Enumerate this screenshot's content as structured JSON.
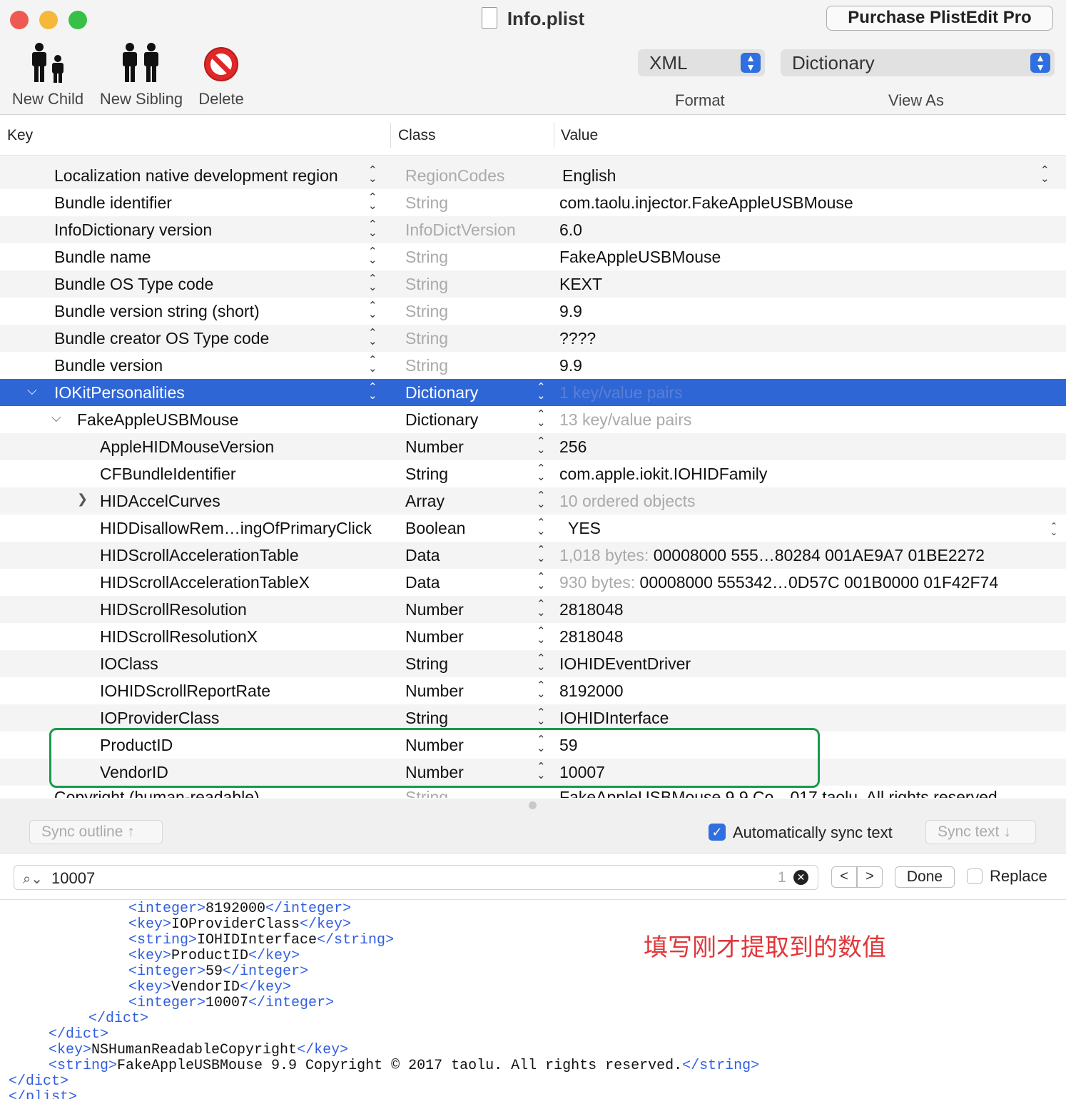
{
  "window": {
    "title": "Info.plist",
    "purchase_button": "Purchase PlistEdit Pro"
  },
  "toolbar": {
    "new_child": "New Child",
    "new_sibling": "New Sibling",
    "delete": "Delete",
    "format_value": "XML",
    "format_label": "Format",
    "view_as_value": "Dictionary",
    "view_as_label": "View As"
  },
  "columns": {
    "key": "Key",
    "class": "Class",
    "value": "Value"
  },
  "rows": [
    {
      "key": "Localization native development region",
      "cls": "RegionCodes",
      "value": "English"
    },
    {
      "key": "Bundle identifier",
      "cls": "String",
      "value": "com.taolu.injector.FakeAppleUSBMouse"
    },
    {
      "key": "InfoDictionary version",
      "cls": "InfoDictVersion",
      "value": "6.0"
    },
    {
      "key": "Bundle name",
      "cls": "String",
      "value": "FakeAppleUSBMouse"
    },
    {
      "key": "Bundle OS Type code",
      "cls": "String",
      "value": "KEXT"
    },
    {
      "key": "Bundle version string (short)",
      "cls": "String",
      "value": "9.9"
    },
    {
      "key": "Bundle creator OS Type code",
      "cls": "String",
      "value": "????"
    },
    {
      "key": "Bundle version",
      "cls": "String",
      "value": "9.9"
    },
    {
      "key": "IOKitPersonalities",
      "cls": "Dictionary",
      "value": "1 key/value pairs"
    },
    {
      "key": "FakeAppleUSBMouse",
      "cls": "Dictionary",
      "value": "13 key/value pairs"
    },
    {
      "key": "AppleHIDMouseVersion",
      "cls": "Number",
      "value": "256"
    },
    {
      "key": "CFBundleIdentifier",
      "cls": "String",
      "value": "com.apple.iokit.IOHIDFamily"
    },
    {
      "key": "HIDAccelCurves",
      "cls": "Array",
      "value": "10 ordered objects"
    },
    {
      "key": "HIDDisallowRem…ingOfPrimaryClick",
      "cls": "Boolean",
      "value": "YES"
    },
    {
      "key": "HIDScrollAccelerationTable",
      "cls": "Data",
      "value_prefix": "1,018 bytes:",
      "value": "00008000 555…80284 001AE9A7 01BE2272"
    },
    {
      "key": "HIDScrollAccelerationTableX",
      "cls": "Data",
      "value_prefix": "930 bytes:",
      "value": "00008000 555342…0D57C 001B0000 01F42F74"
    },
    {
      "key": "HIDScrollResolution",
      "cls": "Number",
      "value": "2818048"
    },
    {
      "key": "HIDScrollResolutionX",
      "cls": "Number",
      "value": "2818048"
    },
    {
      "key": "IOClass",
      "cls": "String",
      "value": "IOHIDEventDriver"
    },
    {
      "key": "IOHIDScrollReportRate",
      "cls": "Number",
      "value": "8192000"
    },
    {
      "key": "IOProviderClass",
      "cls": "String",
      "value": "IOHIDInterface"
    },
    {
      "key": "ProductID",
      "cls": "Number",
      "value": "59"
    },
    {
      "key": "VendorID",
      "cls": "Number",
      "value": "10007"
    },
    {
      "key": "Copyright (human-readable)",
      "cls": "String",
      "value": "FakeAppleUSBMouse 9.9 Co…017 taolu. All rights reserved."
    }
  ],
  "sync": {
    "outline_button": "Sync outline ↑",
    "auto_sync_label": "Automatically sync text",
    "auto_sync_checked": true,
    "text_button": "Sync text ↓"
  },
  "find": {
    "query": "10007",
    "match_count": "1",
    "prev": "<",
    "next": ">",
    "done": "Done",
    "replace_label": "Replace"
  },
  "xml_lines": [
    {
      "parts": [
        [
          "tag",
          "<integer>"
        ],
        [
          "txt",
          "8192000"
        ],
        [
          "tag",
          "</integer>"
        ]
      ]
    },
    {
      "parts": [
        [
          "tag",
          "<key>"
        ],
        [
          "txt",
          "IOProviderClass"
        ],
        [
          "tag",
          "</key>"
        ]
      ]
    },
    {
      "parts": [
        [
          "tag",
          "<string>"
        ],
        [
          "txt",
          "IOHIDInterface"
        ],
        [
          "tag",
          "</string>"
        ]
      ]
    },
    {
      "parts": [
        [
          "tag",
          "<key>"
        ],
        [
          "txt",
          "ProductID"
        ],
        [
          "tag",
          "</key>"
        ]
      ]
    },
    {
      "parts": [
        [
          "tag",
          "<integer>"
        ],
        [
          "txt",
          "59"
        ],
        [
          "tag",
          "</integer>"
        ]
      ]
    },
    {
      "parts": [
        [
          "tag",
          "<key>"
        ],
        [
          "txt",
          "VendorID"
        ],
        [
          "tag",
          "</key>"
        ]
      ]
    },
    {
      "parts": [
        [
          "tag",
          "<integer>"
        ],
        [
          "txt",
          "10007"
        ],
        [
          "tag",
          "</integer>"
        ]
      ]
    },
    {
      "parts": [
        [
          "tag",
          "</dict>"
        ]
      ]
    },
    {
      "parts": [
        [
          "tag",
          "</dict>"
        ]
      ]
    },
    {
      "parts": [
        [
          "tag",
          "<key>"
        ],
        [
          "txt",
          "NSHumanReadableCopyright"
        ],
        [
          "tag",
          "</key>"
        ]
      ]
    },
    {
      "parts": [
        [
          "tag",
          "<string>"
        ],
        [
          "txt",
          "FakeAppleUSBMouse 9.9 Copyright © 2017 taolu. All rights reserved."
        ],
        [
          "tag",
          "</string>"
        ]
      ]
    },
    {
      "parts": [
        [
          "tag",
          "</dict>"
        ]
      ]
    },
    {
      "parts": [
        [
          "tag",
          "</plist>"
        ]
      ]
    }
  ],
  "annotation": "填写刚才提取到的数值",
  "colors": {
    "selection": "#2f66d6",
    "highlight_box": "#1a9a4a",
    "annotation": "#e0383a",
    "xml_tag": "#2f5ee0"
  }
}
